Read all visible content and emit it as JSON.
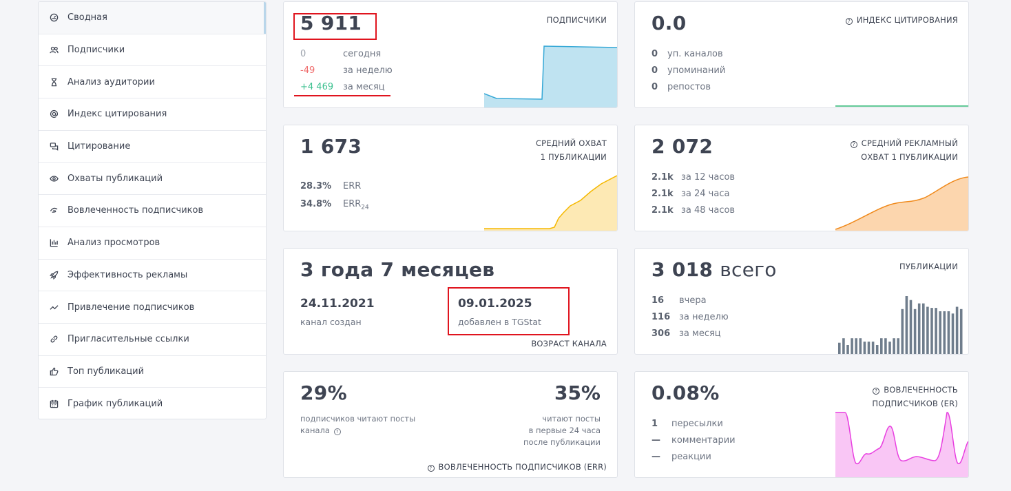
{
  "sidebar": {
    "items": [
      {
        "label": "Сводная",
        "icon": "dashboard-icon",
        "active": true
      },
      {
        "label": "Подписчики",
        "icon": "users-icon"
      },
      {
        "label": "Анализ аудитории",
        "icon": "hourglass-icon"
      },
      {
        "label": "Индекс цитирования",
        "icon": "at-icon"
      },
      {
        "label": "Цитирование",
        "icon": "chat-icon"
      },
      {
        "label": "Охваты публикаций",
        "icon": "eye-icon"
      },
      {
        "label": "Вовлеченность подписчиков",
        "icon": "hand-icon"
      },
      {
        "label": "Анализ просмотров",
        "icon": "bar-chart-icon"
      },
      {
        "label": "Эффективность рекламы",
        "icon": "rocket-icon"
      },
      {
        "label": "Привлечение подписчиков",
        "icon": "trend-icon"
      },
      {
        "label": "Пригласительные ссылки",
        "icon": "link-icon"
      },
      {
        "label": "Топ публикаций",
        "icon": "thumbs-up-icon"
      },
      {
        "label": "График публикаций",
        "icon": "calendar-icon"
      }
    ]
  },
  "subscribers": {
    "value": "5 911",
    "title": "ПОДПИСЧИКИ",
    "rows": [
      {
        "value": "0",
        "label": "сегодня",
        "color": "#9aa0aa"
      },
      {
        "value": "-49",
        "label": "за неделю",
        "color": "#ef6b6b"
      },
      {
        "value": "+4 469",
        "label": "за месяц",
        "color": "#3cc08f"
      }
    ]
  },
  "citation": {
    "value": "0.0",
    "title": "ИНДЕКС ЦИТИРОВАНИЯ",
    "rows": [
      {
        "value": "0",
        "label": "уп. каналов"
      },
      {
        "value": "0",
        "label": "упоминаний"
      },
      {
        "value": "0",
        "label": "репостов"
      }
    ]
  },
  "reach": {
    "value": "1 673",
    "title_line1": "СРЕДНИЙ ОХВАТ",
    "title_line2": "1 ПУБЛИКАЦИИ",
    "rows": [
      {
        "value": "28.3%",
        "label": "ERR",
        "sub": ""
      },
      {
        "value": "34.8%",
        "label": "ERR",
        "sub": "24"
      }
    ]
  },
  "ad_reach": {
    "value": "2 072",
    "title_line1": "СРЕДНИЙ РЕКЛАМНЫЙ",
    "title_line2": "ОХВАТ 1 ПУБЛИКАЦИИ",
    "rows": [
      {
        "value": "2.1k",
        "label": "за 12 часов"
      },
      {
        "value": "2.1k",
        "label": "за 24 часа"
      },
      {
        "value": "2.1k",
        "label": "за 48 часов"
      }
    ]
  },
  "age": {
    "value": "3 года 7 месяцев",
    "created_date": "24.11.2021",
    "created_label": "канал создан",
    "added_date": "09.01.2025",
    "added_label": "добавлен в TGStat",
    "footer": "ВОЗРАСТ КАНАЛА"
  },
  "posts": {
    "value": "3 018",
    "value_suffix": "всего",
    "title": "ПУБЛИКАЦИИ",
    "rows": [
      {
        "value": "16",
        "label": "вчера"
      },
      {
        "value": "116",
        "label": "за неделю"
      },
      {
        "value": "306",
        "label": "за месяц"
      }
    ]
  },
  "err": {
    "left_value": "29%",
    "left_label_1": "подписчиков читают посты",
    "left_label_2": "канала",
    "right_value": "35%",
    "right_label_1": "читают посты",
    "right_label_2": "в первые 24 часа",
    "right_label_3": "после публикации",
    "footer": "ВОВЛЕЧЕННОСТЬ ПОДПИСЧИКОВ (ERR)"
  },
  "er": {
    "value": "0.08%",
    "title_line1": "ВОВЛЕЧЕННОСТЬ",
    "title_line2": "ПОДПИСЧИКОВ (ER)",
    "rows": [
      {
        "value": "1",
        "label": "пересылки"
      },
      {
        "value": "—",
        "label": "комментарии"
      },
      {
        "value": "—",
        "label": "реакции"
      }
    ]
  },
  "colors": {
    "subscribers_chart": "#35a8d6",
    "citation_chart": "#2bb673",
    "reach_chart": "#f5b800",
    "ad_reach_chart": "#f08a1c",
    "posts_bars": "#6f7d8c",
    "er_chart": "#e83fe0",
    "highlight": "#e0141e"
  },
  "posts_bars": [
    2,
    2.8,
    1.6,
    2.8,
    2.8,
    2.8,
    2.2,
    2.2,
    2.2,
    1.6,
    2.8,
    2.8,
    2.2,
    2.8,
    2.8,
    8,
    10.3,
    9.6,
    8,
    9,
    9,
    8.4,
    8.2,
    8.2,
    7.6,
    7.6,
    7.6,
    7.2,
    8.4,
    8
  ]
}
